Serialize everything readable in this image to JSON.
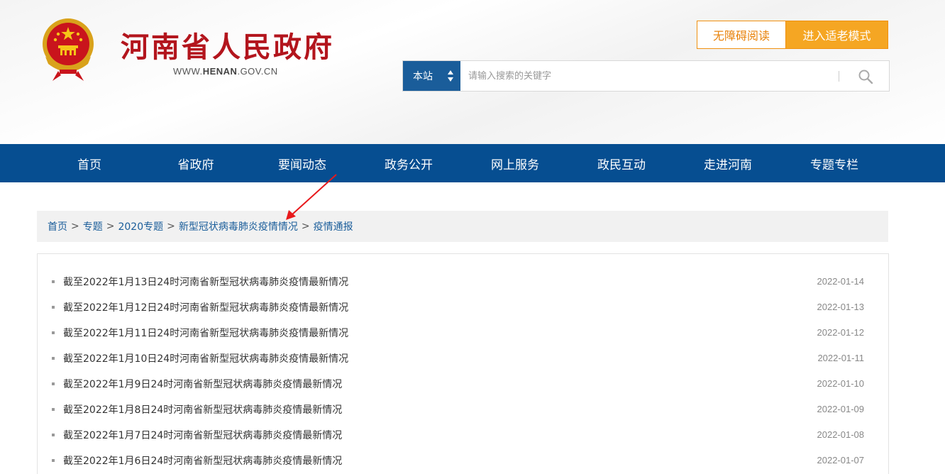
{
  "header": {
    "site_title": "河南省人民政府",
    "site_url_prefix": "WWW.",
    "site_url_domain": "HENAN",
    "site_url_suffix": ".GOV.CN",
    "accessibility_label": "无障碍阅读",
    "elder_mode_label": "进入适老模式"
  },
  "search": {
    "scope": "本站",
    "placeholder": "请输入搜索的关键字",
    "icon": "search-icon"
  },
  "nav": {
    "items": [
      "首页",
      "省政府",
      "要闻动态",
      "政务公开",
      "网上服务",
      "政民互动",
      "走进河南",
      "专题专栏"
    ]
  },
  "breadcrumb": {
    "items": [
      "首页",
      "专题",
      "2020专题",
      "新型冠状病毒肺炎疫情情况",
      "疫情通报"
    ],
    "separator": ">"
  },
  "annotation": {
    "color": "#e8191c",
    "points_to": "breadcrumb item 新型冠状病毒肺炎疫情情况"
  },
  "list": {
    "items": [
      {
        "title": "截至2022年1月13日24时河南省新型冠状病毒肺炎疫情最新情况",
        "date": "2022-01-14"
      },
      {
        "title": "截至2022年1月12日24时河南省新型冠状病毒肺炎疫情最新情况",
        "date": "2022-01-13"
      },
      {
        "title": "截至2022年1月11日24时河南省新型冠状病毒肺炎疫情最新情况",
        "date": "2022-01-12"
      },
      {
        "title": "截至2022年1月10日24时河南省新型冠状病毒肺炎疫情最新情况",
        "date": "2022-01-11"
      },
      {
        "title": "截至2022年1月9日24时河南省新型冠状病毒肺炎疫情最新情况",
        "date": "2022-01-10"
      },
      {
        "title": "截至2022年1月8日24时河南省新型冠状病毒肺炎疫情最新情况",
        "date": "2022-01-09"
      },
      {
        "title": "截至2022年1月7日24时河南省新型冠状病毒肺炎疫情最新情况",
        "date": "2022-01-08"
      },
      {
        "title": "截至2022年1月6日24时河南省新型冠状病毒肺炎疫情最新情况",
        "date": "2022-01-07"
      }
    ]
  },
  "colors": {
    "brand_red": "#b3151d",
    "nav_blue": "#064e91",
    "search_scope_blue": "#1a5d9a",
    "elder_orange": "#f5a623",
    "accessibility_orange": "#e8830c"
  }
}
